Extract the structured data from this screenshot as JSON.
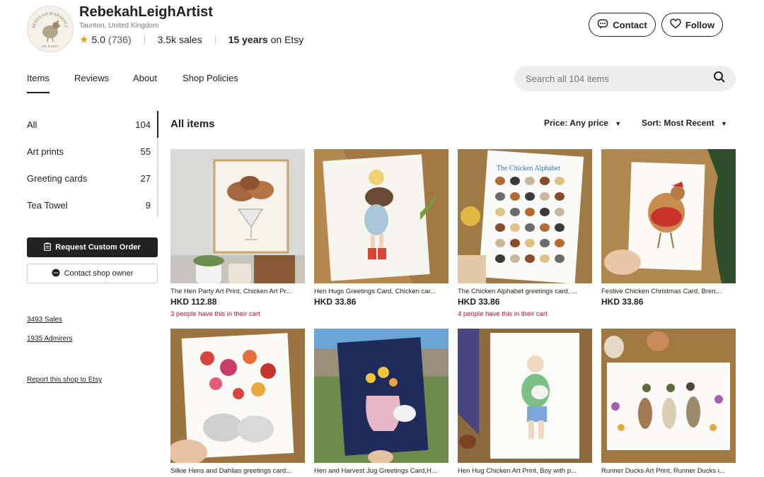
{
  "shop": {
    "name": "RebekahLeighArtist",
    "location": "Taunton, United Kingdom",
    "rating": "5.0",
    "review_count": "(736)",
    "sales_count": "3.5k",
    "sales_word": "sales",
    "years_prefix": "15 years",
    "years_suffix": "on Etsy",
    "logo_text_top": "REBEKAH MARSHALL",
    "logo_text_bottom": "ART & GIFTS"
  },
  "header": {
    "contact_label": "Contact",
    "follow_label": "Follow"
  },
  "tabs": [
    "Items",
    "Reviews",
    "About",
    "Shop Policies"
  ],
  "search": {
    "placeholder": "Search all 104 items"
  },
  "sidebar": {
    "categories": [
      {
        "label": "All",
        "count": "104"
      },
      {
        "label": "Art prints",
        "count": "55"
      },
      {
        "label": "Greeting cards",
        "count": "27"
      },
      {
        "label": "Tea Towel",
        "count": "9"
      }
    ],
    "request_label": "Request Custom Order",
    "contact_owner_label": "Contact shop owner",
    "sales_link": "3493 Sales",
    "admirers_link": "1935 Admirers",
    "report_link": "Report this shop to Etsy"
  },
  "main": {
    "title": "All items",
    "price_filter": "Price: Any price",
    "sort_filter": "Sort: Most Recent"
  },
  "listings": [
    {
      "title": "The Hen Party Art Print, Chicken Art Pr...",
      "price": "HKD 112.88",
      "cart": "3 people have this in their cart"
    },
    {
      "title": "Hen Hugs Greetings Card, Chicken car...",
      "price": "HKD 33.86",
      "cart": ""
    },
    {
      "title": "The Chicken Alphabet greetings card, ...",
      "price": "HKD 33.86",
      "cart": "4 people have this in their cart",
      "card_heading": "The Chicken Alphabet"
    },
    {
      "title": "Festive Chicken Christmas Card, Bren...",
      "price": "HKD 33.86",
      "cart": ""
    },
    {
      "title": "Silkie Hens and Dahlias greetings card...",
      "price": "",
      "cart": ""
    },
    {
      "title": "Hen and Harvest Jug Greetings Card,H...",
      "price": "",
      "cart": ""
    },
    {
      "title": "Hen Hug Chicken Art Print, Boy with p...",
      "price": "",
      "cart": ""
    },
    {
      "title": "Runner Ducks Art Print, Runner Ducks i...",
      "price": "",
      "cart": ""
    }
  ],
  "colors": {
    "accent_star": "#e5a11b",
    "cart_text": "#a61a2e",
    "dark_button": "#222222"
  }
}
